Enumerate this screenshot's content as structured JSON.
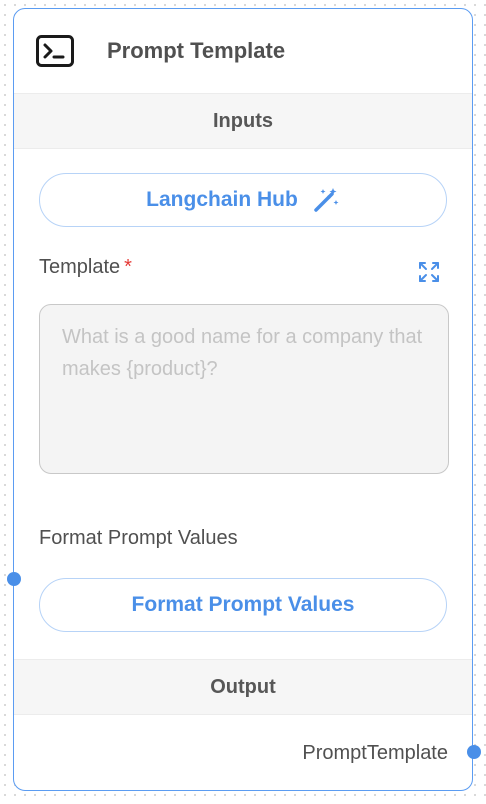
{
  "node": {
    "title": "Prompt Template",
    "icon": "terminal-icon",
    "accent_color": "#4a8fe8"
  },
  "inputs": {
    "section_label": "Inputs",
    "hub_button_label": "Langchain Hub",
    "hub_button_icon": "magic-wand-icon",
    "template_label": "Template",
    "required_marker": "*",
    "template_placeholder": "What is a good name for a company that makes {product}?",
    "template_value": "",
    "format_label": "Format Prompt Values",
    "format_button_label": "Format Prompt Values"
  },
  "output": {
    "section_label": "Output",
    "label": "PromptTemplate"
  }
}
